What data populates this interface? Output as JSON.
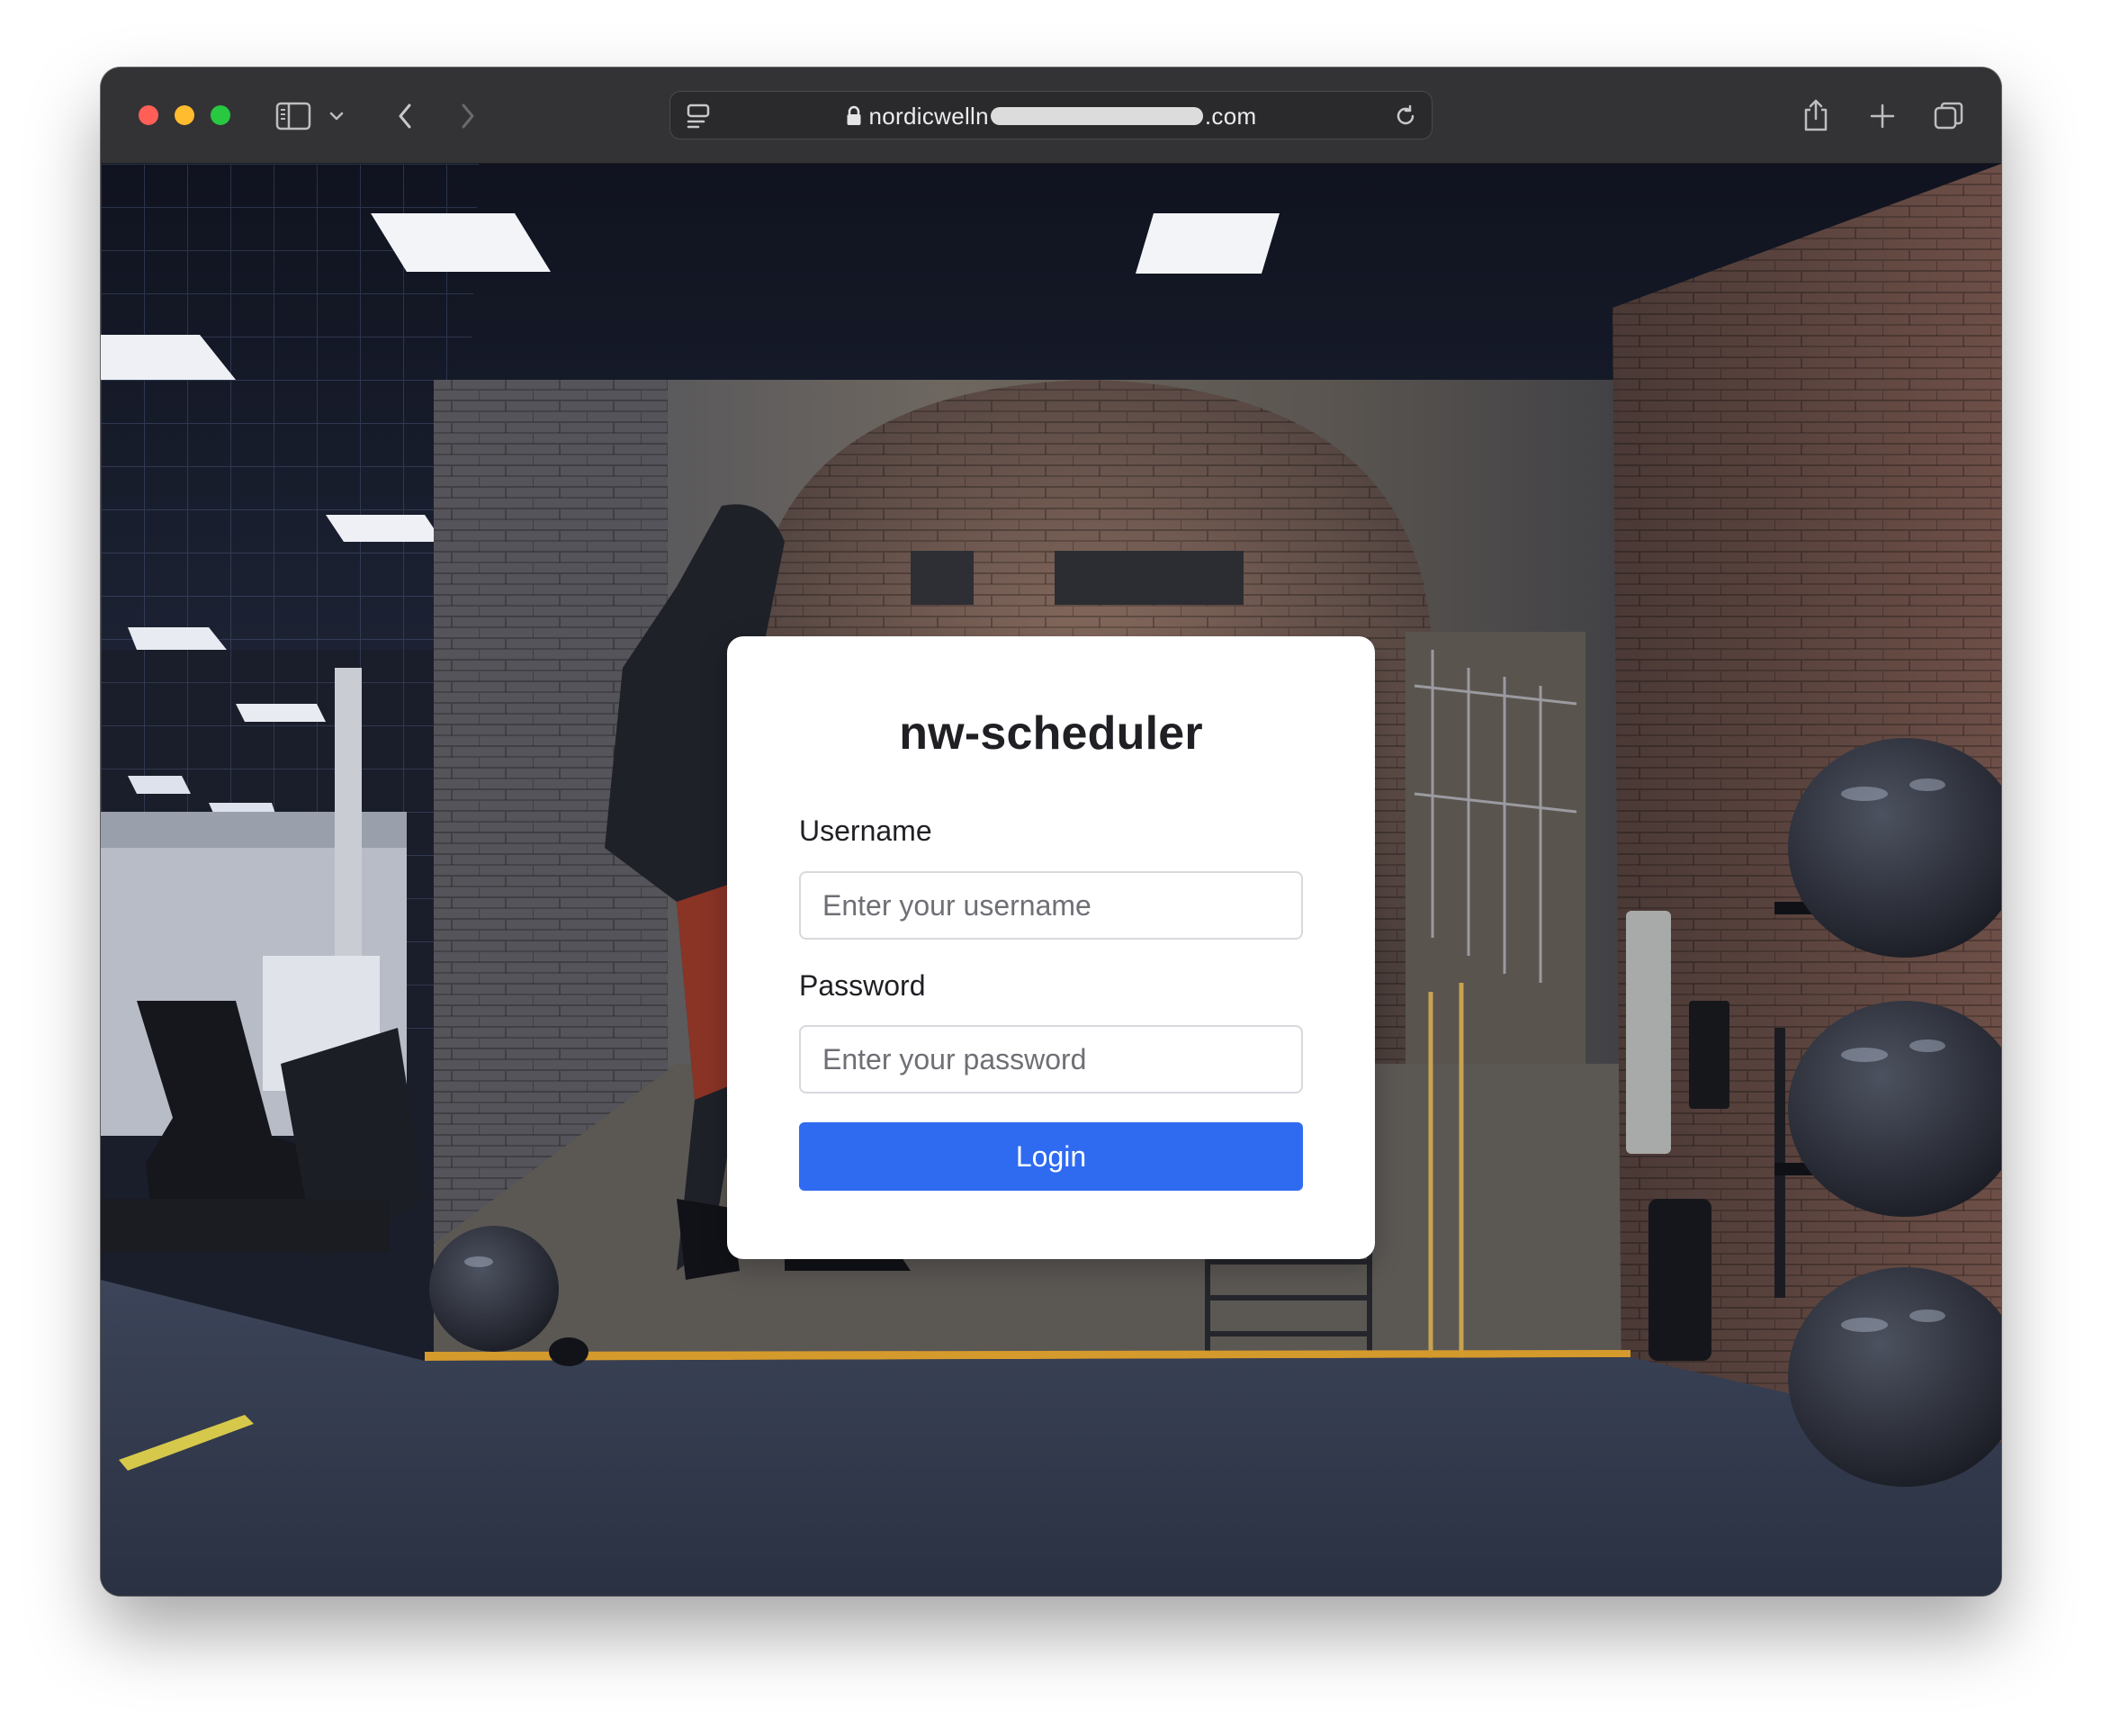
{
  "browser": {
    "address_bar": {
      "url_prefix": "nordicwelln",
      "url_suffix": ".com"
    },
    "icons": {
      "sidebar": "sidebar-icon",
      "sidebar_menu": "chevron-down-icon",
      "back": "chevron-left-icon",
      "forward": "chevron-right-icon",
      "page_menu": "page-menu-icon",
      "lock": "lock-icon",
      "reload": "reload-icon",
      "share": "share-icon",
      "new_tab": "plus-icon",
      "tab_overview": "tabs-icon"
    }
  },
  "login": {
    "title": "nw-scheduler",
    "username_label": "Username",
    "username_placeholder": "Enter your username",
    "username_value": "",
    "password_label": "Password",
    "password_placeholder": "Enter your password",
    "password_value": "",
    "submit_label": "Login"
  },
  "colors": {
    "button": "#2f6bf1",
    "card": "#ffffff",
    "toolbar": "#333336"
  }
}
